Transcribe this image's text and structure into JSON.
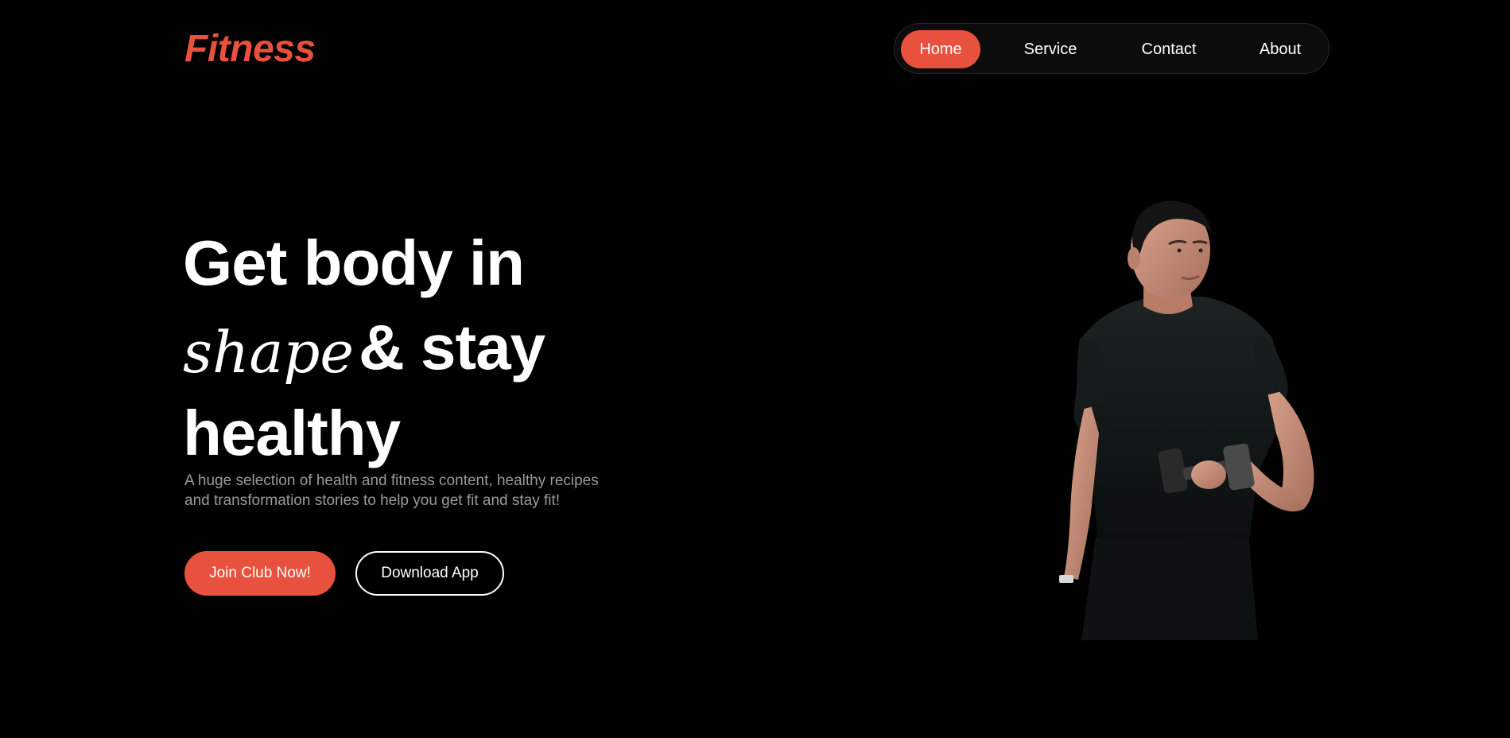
{
  "brand": {
    "logo": "Fitness",
    "accent_color": "#e8513e"
  },
  "nav": {
    "items": [
      {
        "label": "Home",
        "active": true
      },
      {
        "label": "Service",
        "active": false
      },
      {
        "label": "Contact",
        "active": false
      },
      {
        "label": "About",
        "active": false
      }
    ]
  },
  "hero": {
    "title_line1": "Get body in",
    "title_script": "shape",
    "title_line2_rest": "& stay",
    "title_line3": "healthy",
    "subtitle_line1": "A huge selection of health and fitness content, healthy recipes",
    "subtitle_line2": "and transformation stories to help you get fit and stay fit!",
    "primary_button": "Join Club Now!",
    "secondary_button": "Download App"
  }
}
